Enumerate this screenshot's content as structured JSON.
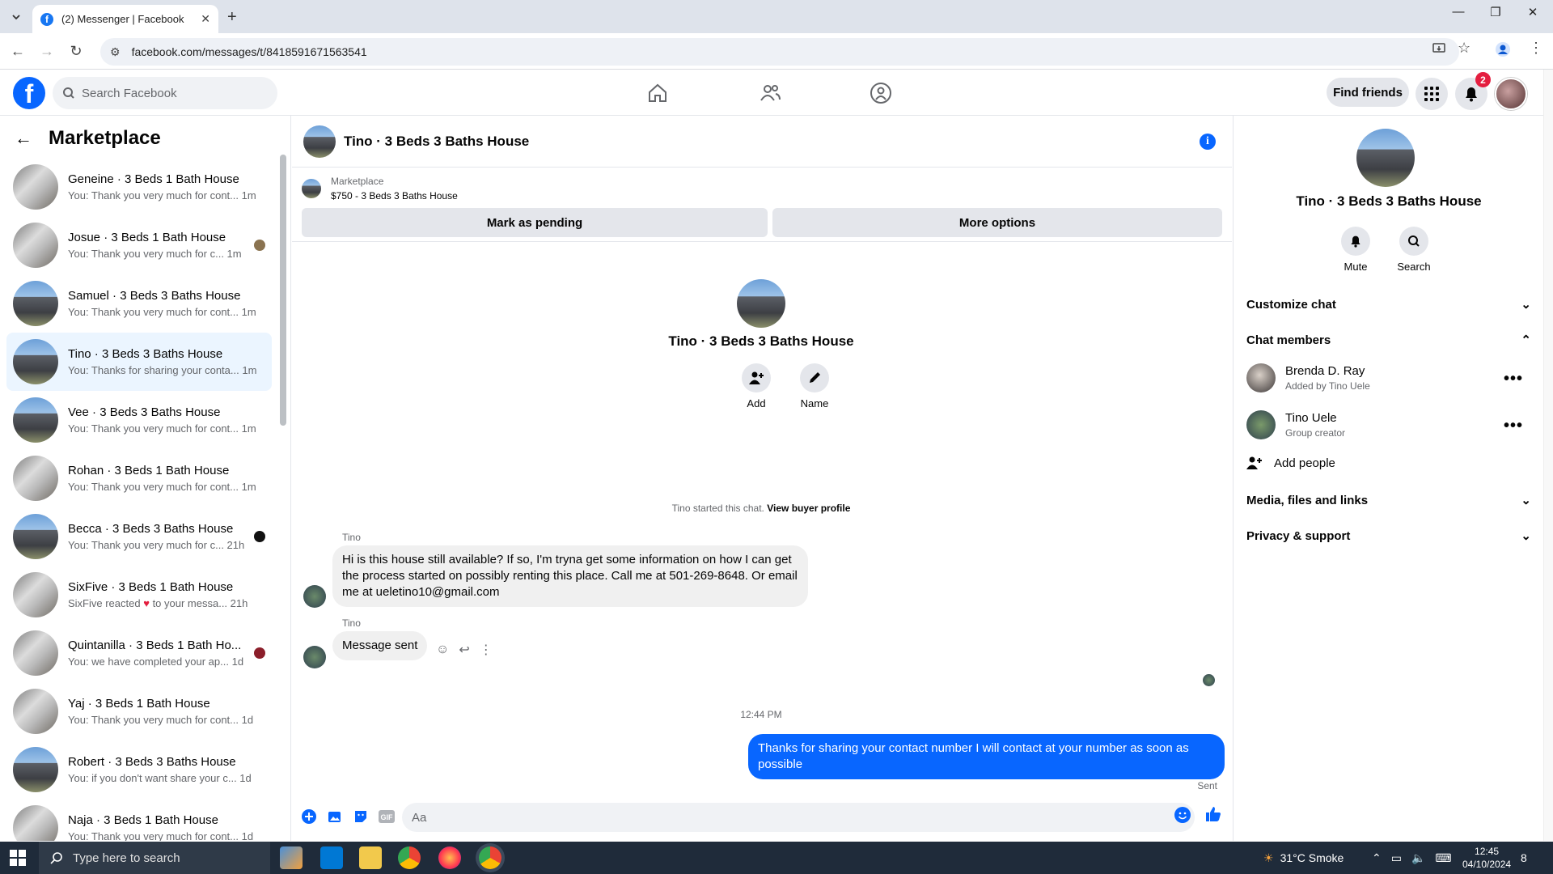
{
  "browser": {
    "tab_title": "(2) Messenger | Facebook",
    "url": "facebook.com/messages/t/8418591671563541"
  },
  "fb": {
    "search_placeholder": "Search Facebook",
    "find_friends": "Find friends",
    "notif_count": "2"
  },
  "sidebar": {
    "title": "Marketplace",
    "conversations": [
      {
        "name": "Geneine · 3 Beds 1 Bath House",
        "preview": "You: Thank you very much for cont... 1m"
      },
      {
        "name": "Josue · 3 Beds 1 Bath House",
        "preview": "You: Thank you very much for c... 1m"
      },
      {
        "name": "Samuel · 3 Beds 3 Baths House",
        "preview": "You: Thank you very much for cont... 1m"
      },
      {
        "name": "Tino · 3 Beds 3 Baths House",
        "preview": "You: Thanks for sharing your conta... 1m"
      },
      {
        "name": "Vee · 3 Beds 3 Baths House",
        "preview": "You: Thank you very much for cont... 1m"
      },
      {
        "name": "Rohan · 3 Beds 1 Bath House",
        "preview": "You: Thank you very much for cont... 1m"
      },
      {
        "name": "Becca · 3 Beds 3 Baths House",
        "preview": "You: Thank you very much for c... 21h"
      },
      {
        "name": "SixFive · 3 Beds 1 Bath House",
        "preview_a": "SixFive reacted",
        "preview_b": "to your messa... 21h"
      },
      {
        "name": "Quintanilla · 3 Beds 1 Bath Ho...",
        "preview": "You: we have completed your ap... 1d"
      },
      {
        "name": "Yaj · 3 Beds 1 Bath House",
        "preview": "You: Thank you very much for cont... 1d"
      },
      {
        "name": "Robert · 3 Beds 3 Baths House",
        "preview": "You: if you don't want share your c... 1d"
      },
      {
        "name": "Naja · 3 Beds 1 Bath House",
        "preview": "You: Thank you very much for cont... 1d"
      }
    ]
  },
  "chat": {
    "title": "Tino · 3 Beds 3 Baths House",
    "marketplace_label": "Marketplace",
    "listing": "$750 - 3 Beds 3 Baths House",
    "mark_pending": "Mark as pending",
    "more_options": "More options",
    "intro_title": "Tino · 3 Beds 3 Baths House",
    "add_label": "Add",
    "name_label": "Name",
    "started_text": "Tino started this chat.",
    "view_buyer": "View buyer profile",
    "sender1": "Tino",
    "msg1": "Hi is this house still available? If so, I'm tryna get some information on how I can get the process started on possibly renting this place. Call me at 501-269-8648. Or email me at ueletino10@gmail.com",
    "sender2": "Tino",
    "msg2": "Message sent",
    "timestamp": "12:44 PM",
    "msg_out": "Thanks for sharing your contact number I will contact at your number as soon as possible",
    "sent_label": "Sent",
    "composer_placeholder": "Aa"
  },
  "rpanel": {
    "title": "Tino · 3 Beds 3 Baths House",
    "mute": "Mute",
    "search": "Search",
    "customize": "Customize chat",
    "members_header": "Chat members",
    "members": [
      {
        "name": "Brenda D. Ray",
        "sub": "Added by Tino Uele"
      },
      {
        "name": "Tino Uele",
        "sub": "Group creator"
      }
    ],
    "add_people": "Add people",
    "media": "Media, files and links",
    "privacy": "Privacy & support"
  },
  "taskbar": {
    "search_placeholder": "Type here to search",
    "weather": "31°C  Smoke",
    "time": "12:45",
    "date": "04/10/2024",
    "notif_count": "8"
  }
}
